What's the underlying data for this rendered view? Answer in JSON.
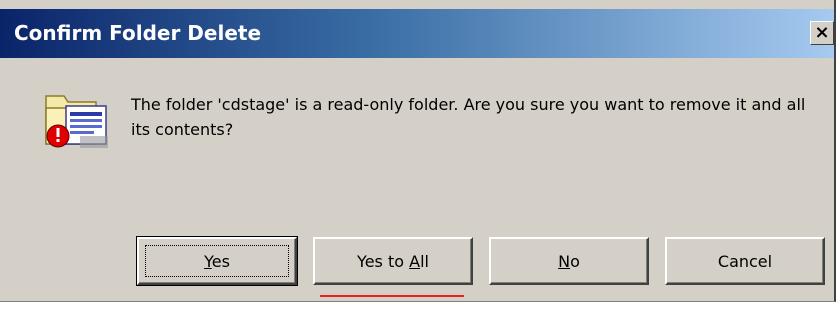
{
  "dialog": {
    "title": "Confirm Folder Delete",
    "close_label": "×",
    "message": "The folder 'cdstage' is a read-only folder. Are you sure you want to remove it and all its contents?",
    "icon": "folder-delete-warning-icon"
  },
  "buttons": {
    "yes": {
      "pre": "",
      "accel": "Y",
      "post": "es"
    },
    "yes_to_all": {
      "pre": "Yes to ",
      "accel": "A",
      "post": "ll"
    },
    "no": {
      "pre": "",
      "accel": "N",
      "post": "o"
    },
    "cancel": {
      "pre": "Cancel",
      "accel": "",
      "post": ""
    }
  },
  "colors": {
    "title_gradient_start": "#0a246a",
    "title_gradient_end": "#a6caf0",
    "dialog_face": "#d4d0c8",
    "highlight_underline": "#e8201e"
  }
}
